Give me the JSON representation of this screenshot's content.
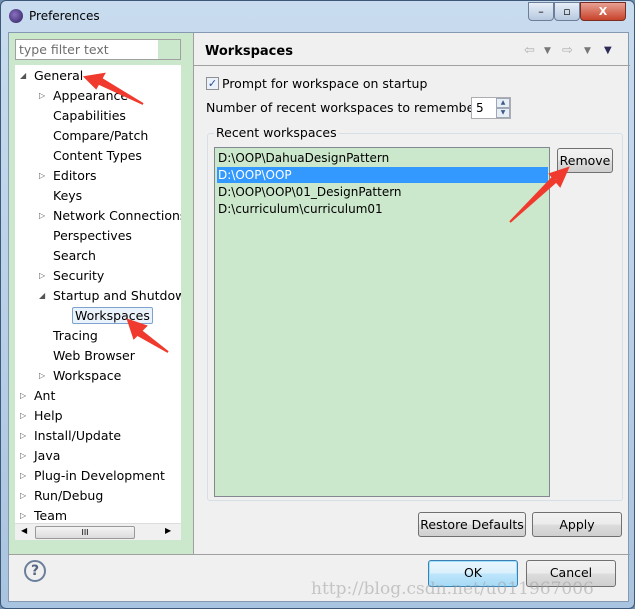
{
  "window": {
    "title": "Preferences",
    "minimize": "–",
    "maximize": "▫",
    "close": "X"
  },
  "filter": {
    "placeholder": "type filter text"
  },
  "tree": [
    {
      "label": "General",
      "level": 0,
      "twisty": "expanded"
    },
    {
      "label": "Appearance",
      "level": 1,
      "twisty": "collapsed"
    },
    {
      "label": "Capabilities",
      "level": 1,
      "twisty": ""
    },
    {
      "label": "Compare/Patch",
      "level": 1,
      "twisty": ""
    },
    {
      "label": "Content Types",
      "level": 1,
      "twisty": ""
    },
    {
      "label": "Editors",
      "level": 1,
      "twisty": "collapsed"
    },
    {
      "label": "Keys",
      "level": 1,
      "twisty": ""
    },
    {
      "label": "Network Connections",
      "level": 1,
      "twisty": "collapsed"
    },
    {
      "label": "Perspectives",
      "level": 1,
      "twisty": ""
    },
    {
      "label": "Search",
      "level": 1,
      "twisty": ""
    },
    {
      "label": "Security",
      "level": 1,
      "twisty": "collapsed"
    },
    {
      "label": "Startup and Shutdown",
      "level": 1,
      "twisty": "expanded"
    },
    {
      "label": "Workspaces",
      "level": 2,
      "twisty": "",
      "selected": true
    },
    {
      "label": "Tracing",
      "level": 1,
      "twisty": ""
    },
    {
      "label": "Web Browser",
      "level": 1,
      "twisty": ""
    },
    {
      "label": "Workspace",
      "level": 1,
      "twisty": "collapsed"
    },
    {
      "label": "Ant",
      "level": 0,
      "twisty": "collapsed"
    },
    {
      "label": "Help",
      "level": 0,
      "twisty": "collapsed"
    },
    {
      "label": "Install/Update",
      "level": 0,
      "twisty": "collapsed"
    },
    {
      "label": "Java",
      "level": 0,
      "twisty": "collapsed"
    },
    {
      "label": "Plug-in Development",
      "level": 0,
      "twisty": "collapsed"
    },
    {
      "label": "Run/Debug",
      "level": 0,
      "twisty": "collapsed"
    },
    {
      "label": "Team",
      "level": 0,
      "twisty": "collapsed"
    }
  ],
  "page": {
    "title": "Workspaces",
    "prompt_label": "Prompt for workspace on startup",
    "prompt_checked": true,
    "recent_count_label": "Number of recent workspaces to remember:",
    "recent_count": "5",
    "group_label": "Recent workspaces",
    "workspaces": [
      "D:\\OOP\\DahuaDesignPattern",
      "D:\\OOP\\OOP",
      "D:\\OOP\\OOP\\01_DesignPattern",
      "D:\\curriculum\\curriculum01"
    ],
    "selected_index": 1,
    "remove": "Remove",
    "restore_defaults": "Restore Defaults",
    "apply": "Apply"
  },
  "footer": {
    "help": "?",
    "ok": "OK",
    "cancel": "Cancel"
  },
  "watermark": "http://blog.csdn.net/u011967006",
  "colors": {
    "list_bg": "#cce8cc",
    "selection": "#3399ff",
    "annotation_arrow": "#f03a2e"
  }
}
